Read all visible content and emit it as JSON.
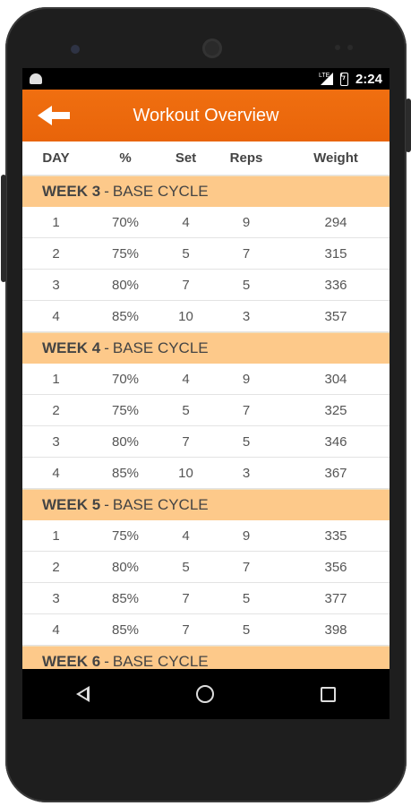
{
  "status_bar": {
    "network": "LTE",
    "time": "2:24"
  },
  "app_bar": {
    "title": "Workout Overview",
    "back_icon": "arrow-back-icon"
  },
  "columns": [
    "DAY",
    "%",
    "Set",
    "Reps",
    "Weight"
  ],
  "weeks": [
    {
      "label": "WEEK 3",
      "cycle": "BASE CYCLE",
      "rows": [
        [
          "1",
          "70%",
          "4",
          "9",
          "294"
        ],
        [
          "2",
          "75%",
          "5",
          "7",
          "315"
        ],
        [
          "3",
          "80%",
          "7",
          "5",
          "336"
        ],
        [
          "4",
          "85%",
          "10",
          "3",
          "357"
        ]
      ]
    },
    {
      "label": "WEEK 4",
      "cycle": "BASE CYCLE",
      "rows": [
        [
          "1",
          "70%",
          "4",
          "9",
          "304"
        ],
        [
          "2",
          "75%",
          "5",
          "7",
          "325"
        ],
        [
          "3",
          "80%",
          "7",
          "5",
          "346"
        ],
        [
          "4",
          "85%",
          "10",
          "3",
          "367"
        ]
      ]
    },
    {
      "label": "WEEK 5",
      "cycle": "BASE CYCLE",
      "rows": [
        [
          "1",
          "75%",
          "4",
          "9",
          "335"
        ],
        [
          "2",
          "80%",
          "5",
          "7",
          "356"
        ],
        [
          "3",
          "85%",
          "7",
          "5",
          "377"
        ],
        [
          "4",
          "85%",
          "7",
          "5",
          "398"
        ]
      ]
    },
    {
      "label": "WEEK 6",
      "cycle": "BASE CYCLE",
      "rows": []
    }
  ],
  "colors": {
    "app_bar": "#ef6c00",
    "week_header": "#fdc98a",
    "status_bar": "#000000"
  }
}
